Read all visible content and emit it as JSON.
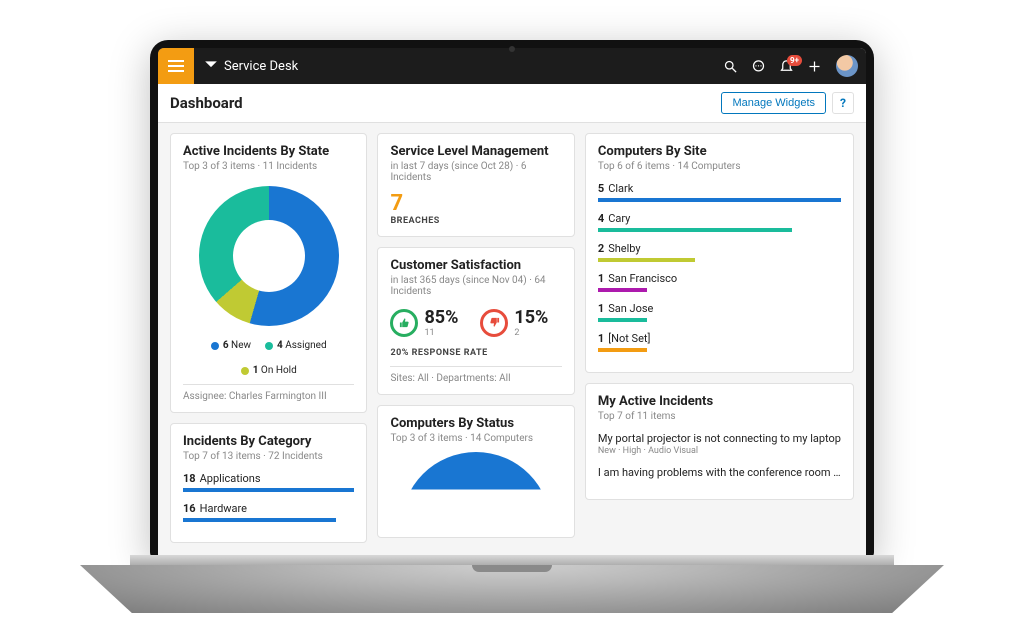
{
  "app": {
    "name": "Service Desk"
  },
  "header": {
    "notification_badge": "9+",
    "page_title": "Dashboard",
    "manage_widgets": "Manage Widgets",
    "help": "?"
  },
  "widgets": {
    "active_incidents": {
      "title": "Active Incidents By State",
      "sub": "Top 3 of 3 items  ·  11 Incidents",
      "legend": [
        {
          "count": "6",
          "label": "New",
          "color": "#1976d2"
        },
        {
          "count": "4",
          "label": "Assigned",
          "color": "#1abc9c"
        },
        {
          "count": "1",
          "label": "On Hold",
          "color": "#c0ca33"
        }
      ],
      "footer": "Assignee: Charles Farmington III"
    },
    "incidents_by_category": {
      "title": "Incidents By Category",
      "sub": "Top 7 of 13 items  ·  72 Incidents",
      "rows": [
        {
          "count": "18",
          "label": "Applications",
          "pct": 100
        },
        {
          "count": "16",
          "label": "Hardware",
          "pct": 89
        }
      ]
    },
    "slm": {
      "title": "Service Level Management",
      "sub": "in last 7 days (since Oct 28)  ·  6 Incidents",
      "value": "7",
      "label": "BREACHES"
    },
    "csat": {
      "title": "Customer Satisfaction",
      "sub": "in last 365 days (since Nov 04)  ·  64 Incidents",
      "pos_pct": "85%",
      "pos_n": "11",
      "neg_pct": "15%",
      "neg_n": "2",
      "response": "20% RESPONSE RATE",
      "footer": "Sites: All   ·   Departments: All"
    },
    "computers_by_status": {
      "title": "Computers By Status",
      "sub": "Top 3 of 3 items  ·  14 Computers"
    },
    "computers_by_site": {
      "title": "Computers By Site",
      "sub": "Top 6 of 6 items  ·  14 Computers",
      "rows": [
        {
          "count": "5",
          "label": "Clark",
          "pct": 100,
          "color": "#1976d2"
        },
        {
          "count": "4",
          "label": "Cary",
          "pct": 80,
          "color": "#1abc9c"
        },
        {
          "count": "2",
          "label": "Shelby",
          "pct": 40,
          "color": "#c0ca33"
        },
        {
          "count": "1",
          "label": "San Francisco",
          "pct": 20,
          "color": "#ad1aad"
        },
        {
          "count": "1",
          "label": "San Jose",
          "pct": 20,
          "color": "#1abc9c"
        },
        {
          "count": "1",
          "label": "[Not Set]",
          "pct": 20,
          "color": "#f39c12"
        }
      ]
    },
    "my_active": {
      "title": "My Active Incidents",
      "sub": "Top 7 of 11 items",
      "items": [
        {
          "title": "My portal projector is not connecting to my laptop",
          "meta": "New  ·  High  ·  Audio Visual"
        },
        {
          "title": "I am having problems with the conference room …",
          "meta": ""
        }
      ]
    }
  },
  "chart_data": [
    {
      "type": "pie",
      "title": "Active Incidents By State",
      "series": [
        {
          "name": "New",
          "value": 6,
          "color": "#1976d2"
        },
        {
          "name": "Assigned",
          "value": 4,
          "color": "#1abc9c"
        },
        {
          "name": "On Hold",
          "value": 1,
          "color": "#c0ca33"
        }
      ],
      "total": 11
    },
    {
      "type": "bar",
      "title": "Incidents By Category",
      "categories": [
        "Applications",
        "Hardware"
      ],
      "values": [
        18,
        16
      ]
    },
    {
      "type": "bar",
      "title": "Computers By Site",
      "categories": [
        "Clark",
        "Cary",
        "Shelby",
        "San Francisco",
        "San Jose",
        "[Not Set]"
      ],
      "values": [
        5,
        4,
        2,
        1,
        1,
        1
      ]
    }
  ]
}
